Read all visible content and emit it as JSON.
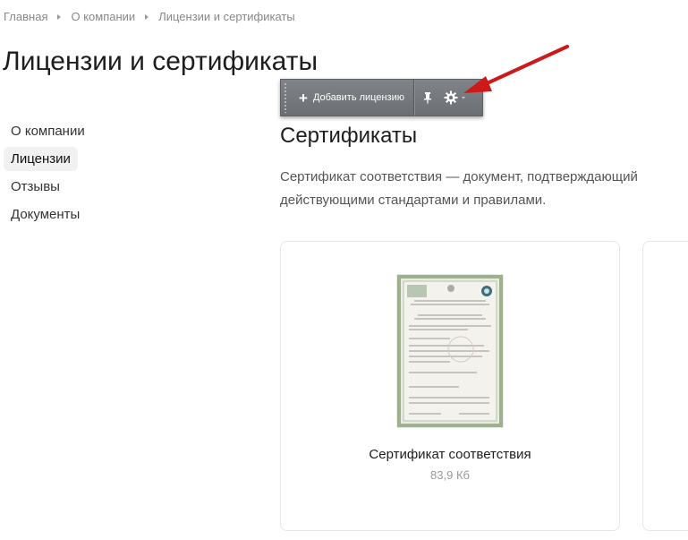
{
  "breadcrumb": [
    {
      "label": "Главная"
    },
    {
      "label": "О компании"
    },
    {
      "label": "Лицензии и сертификаты"
    }
  ],
  "page_title": "Лицензии и сертификаты",
  "sidebar": {
    "items": [
      {
        "label": "О компании",
        "active": false
      },
      {
        "label": "Лицензии",
        "active": true
      },
      {
        "label": "Отзывы",
        "active": false
      },
      {
        "label": "Документы",
        "active": false
      }
    ]
  },
  "toolbar": {
    "add_label": "Добавить лицензию",
    "icons": [
      "plus-icon",
      "pin-icon",
      "gear-icon",
      "caret-down-icon"
    ]
  },
  "section": {
    "title": "Сертификаты",
    "description_line1": "Сертификат соответствия — документ, подтверждающий",
    "description_line2": "действующими стандартами и правилами."
  },
  "cards": [
    {
      "title": "Сертификат соответствия",
      "size": "83,9 Кб"
    }
  ],
  "colors": {
    "arrow": "#cc1a1a",
    "toolbar_bg": "#75797d",
    "active_item_bg": "#f1f1f1"
  }
}
